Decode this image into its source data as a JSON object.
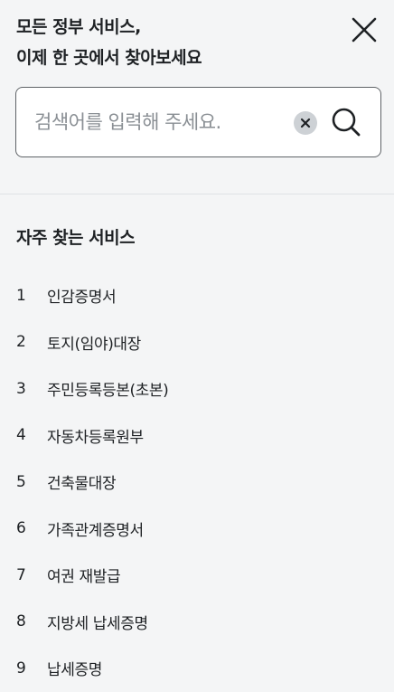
{
  "header": {
    "title_line1": "모든 정부 서비스,",
    "title_line2": "이제 한 곳에서 찾아보세요",
    "close_icon": "close-icon"
  },
  "search": {
    "placeholder": "검색어를 입력해 주세요.",
    "value": "",
    "clear_icon": "clear-circle-icon",
    "search_icon": "magnifier-icon"
  },
  "popular": {
    "title": "자주 찾는 서비스",
    "items": [
      {
        "rank": "1",
        "label": "인감증명서"
      },
      {
        "rank": "2",
        "label": "토지(임야)대장"
      },
      {
        "rank": "3",
        "label": "주민등록등본(초본)"
      },
      {
        "rank": "4",
        "label": "자동차등록원부"
      },
      {
        "rank": "5",
        "label": "건축물대장"
      },
      {
        "rank": "6",
        "label": "가족관계증명서"
      },
      {
        "rank": "7",
        "label": "여권 재발급"
      },
      {
        "rank": "8",
        "label": "지방세 납세증명"
      },
      {
        "rank": "9",
        "label": "납세증명"
      }
    ]
  },
  "colors": {
    "background": "#f4f5f6",
    "text": "#1e2124",
    "input_border": "#5f6367",
    "placeholder": "#8a8f94",
    "clear_button": "#cdd1d5",
    "divider": "#dfe2e5"
  }
}
